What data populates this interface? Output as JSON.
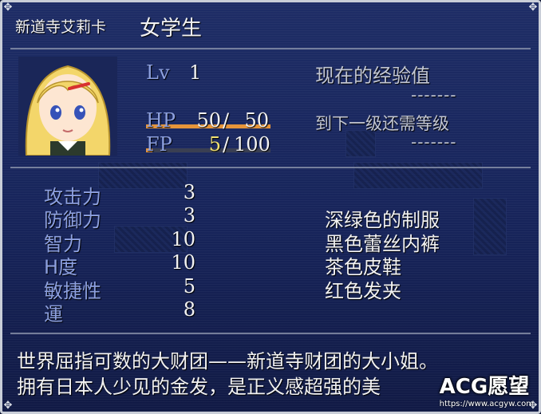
{
  "header": {
    "name": "新道寺艾莉卡",
    "class": "女学生"
  },
  "level": {
    "label": "Lv",
    "value": "1"
  },
  "exp": {
    "current_label": "现在的经验值",
    "current_value": "-------",
    "next_label": "到下一级还需等级",
    "next_value": "-------"
  },
  "hp": {
    "label": "HP",
    "current": "50",
    "sep": "/",
    "max": "50",
    "fill": 1.0,
    "color": "#e6953a"
  },
  "fp": {
    "label": "FP",
    "current": "5",
    "sep": "/",
    "max": "100",
    "fill": 0.05,
    "color": "#e6953a",
    "current_color": "#f0e070"
  },
  "stats": [
    {
      "label": "攻击力",
      "value": "3"
    },
    {
      "label": "防御力",
      "value": "3"
    },
    {
      "label": "智力",
      "value": "10"
    },
    {
      "label": "H度",
      "value": "10"
    },
    {
      "label": "敏捷性",
      "value": "5"
    },
    {
      "label": "運",
      "value": "8"
    }
  ],
  "equipment": [
    "深绿色的制服",
    "黑色蕾丝内裤",
    "茶色皮鞋",
    "红色发夹"
  ],
  "description": [
    "世界屈指可数的大财团——新道寺财团的大小姐。",
    "拥有日本人少见的金发，是正义感超强的美"
  ],
  "watermark": {
    "brand": "ACG愿望",
    "url": "https://www.acgyw.com"
  },
  "portrait": {
    "icon": "blonde-girl-portrait"
  }
}
